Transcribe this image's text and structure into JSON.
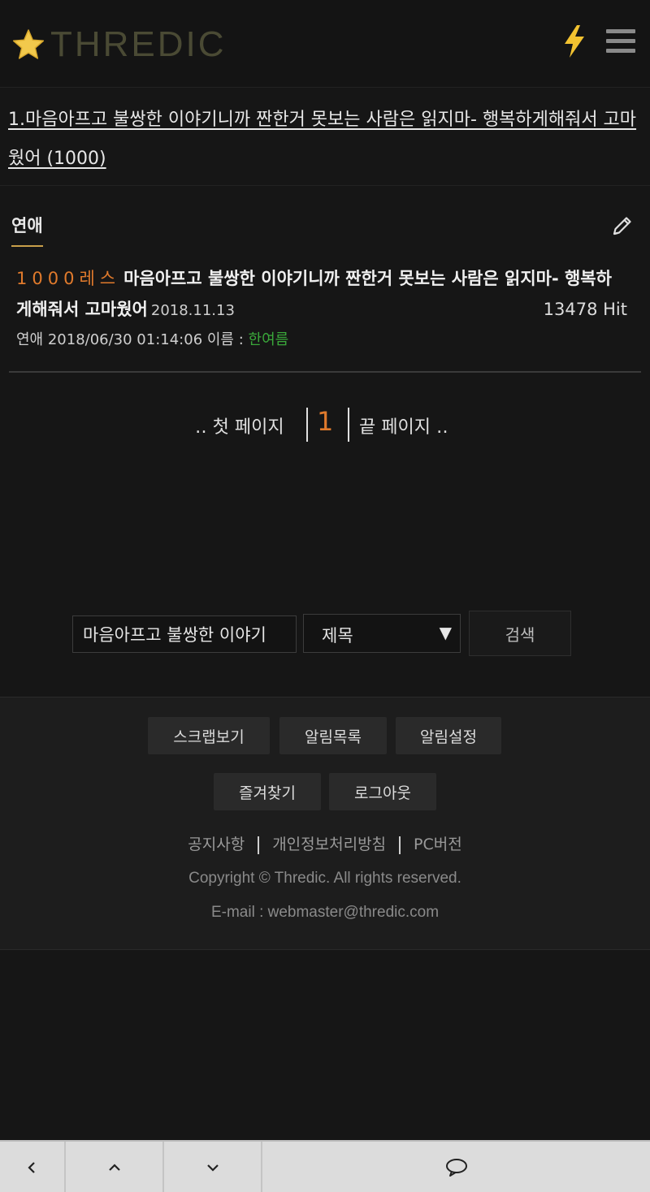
{
  "header": {
    "logo_text": "THREDIC",
    "logo_star": "star-icon",
    "bolt_icon": "lightning-bolt-icon",
    "menu_icon": "hamburger-menu-icon",
    "colors": {
      "star": "#f2c94c",
      "bolt": "#f2c230",
      "logo_text": "#4a4a34"
    }
  },
  "thread": {
    "title_line": "1.마음아프고 불쌍한 이야기니까 짠한거 못보는 사람은 읽지마- 행복하게해줘서 고마웠어 (1000)"
  },
  "board": {
    "tab_label": "연애",
    "edit_icon": "pencil-icon"
  },
  "post": {
    "res_label": "1000레스",
    "title": "마음아프고 불쌍한 이야기니까 짠한거 못보는 사람은 읽지마- 행복하게해줘서 고마웠어",
    "date": "2018.11.13",
    "hits": "13478 Hit",
    "meta_prefix": "연애 2018/06/30 01:14:06 이름 : ",
    "author": "한여름"
  },
  "pager": {
    "first": "‥ 첫 페이지",
    "current": "1",
    "last": "끝 페이지 ‥"
  },
  "search": {
    "value": "마음아프고 불쌍한 이야기",
    "select_value": "제목",
    "arrow": "▼",
    "button": "검색"
  },
  "footer": {
    "buttons_row1": [
      "스크랩보기",
      "알림목록",
      "알림설정"
    ],
    "buttons_row2": [
      "즐겨찾기",
      "로그아웃"
    ],
    "links": [
      "공지사항",
      "개인정보처리방침",
      "PC버전"
    ],
    "copyright": "Copyright © Thredic. All rights reserved.",
    "email": "E-mail : webmaster@thredic.com"
  },
  "bottom_nav": {
    "icons": [
      "chevron-left-icon",
      "chevron-up-icon",
      "chevron-down-icon",
      "comment-icon"
    ]
  }
}
